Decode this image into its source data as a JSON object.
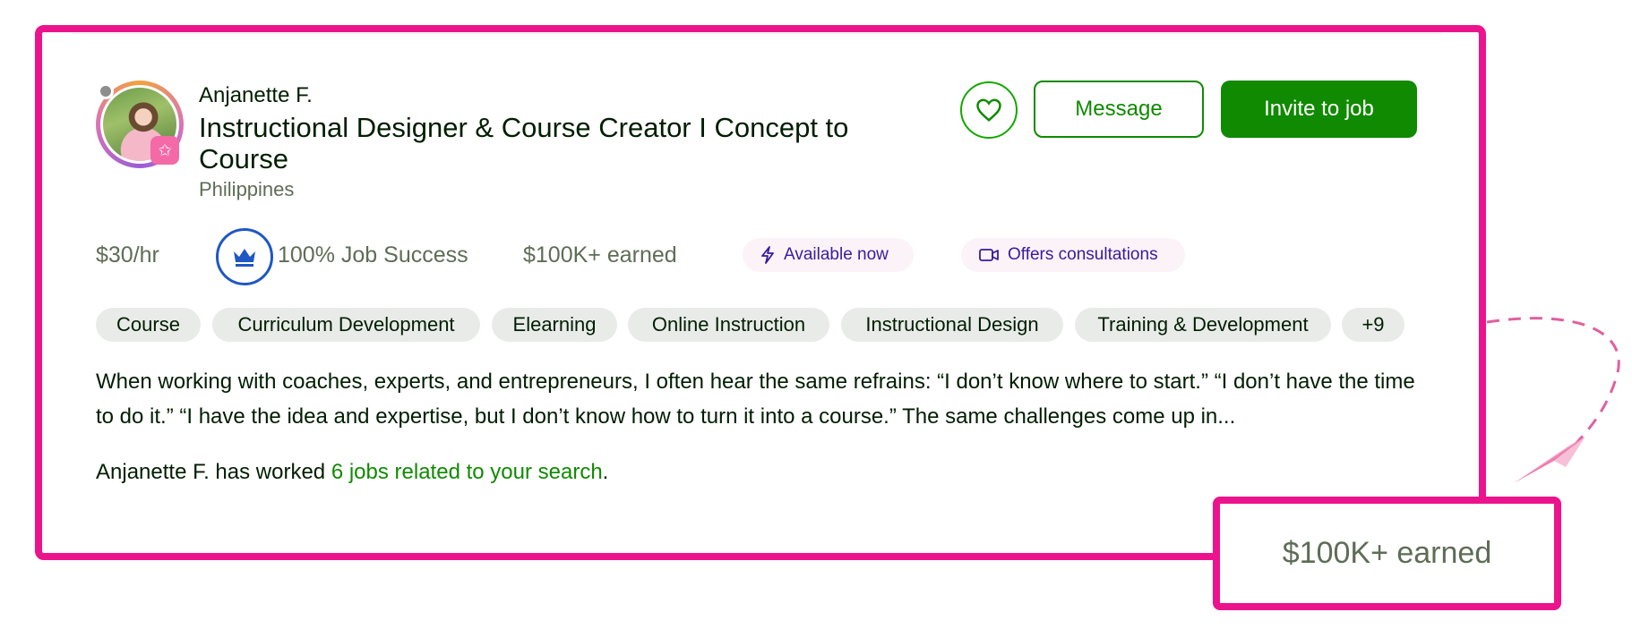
{
  "freelancer": {
    "name": "Anjanette F.",
    "title": "Instructional Designer & Course Creator I Concept to Course",
    "country": "Philippines"
  },
  "actions": {
    "favorite_icon": "heart-icon",
    "message_label": "Message",
    "invite_label": "Invite to job"
  },
  "stats": {
    "rate": "$30/hr",
    "job_success": "100% Job Success",
    "earned": "$100K+ earned",
    "available": "Available now",
    "consultations": "Offers consultations"
  },
  "skills": [
    "Course",
    "Curriculum Development",
    "Elearning",
    "Online Instruction",
    "Instructional Design",
    "Training & Development",
    "+9"
  ],
  "description": "When working with coaches, experts, and entrepreneurs, I often hear the same refrains: “I don’t know where to start.” “I don’t have the time to do it.” “I have the idea and expertise, but I don’t know how to turn it into a course.” The same challenges come up in...",
  "jobs_line": {
    "prefix": "Anjanette F. has worked ",
    "link": "6 jobs related to your search",
    "suffix": "."
  },
  "callout": {
    "text": "$100K+ earned"
  },
  "colors": {
    "highlight": "#ec148c",
    "primary_green": "#108a00",
    "badge_blue": "#1f57c3",
    "muted_text": "#5e6d55"
  }
}
